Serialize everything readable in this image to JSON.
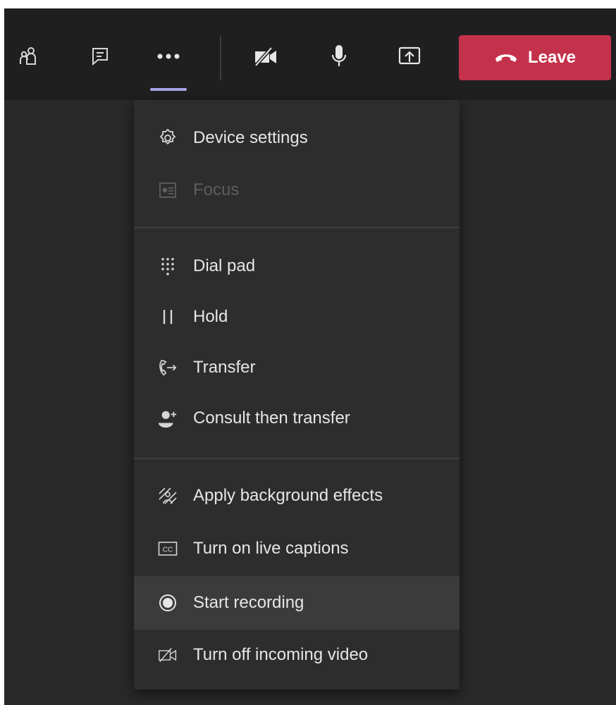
{
  "toolbar": {
    "participants_icon": "people-icon",
    "chat_icon": "chat-icon",
    "more_icon": "more-options-icon",
    "camera_icon": "camera-off-icon",
    "mic_icon": "microphone-icon",
    "share_icon": "share-screen-icon",
    "leave_label": "Leave",
    "leave_color": "#c4314b"
  },
  "menu": {
    "sections": [
      {
        "items": [
          {
            "label": "Device settings",
            "icon": "gear-icon",
            "enabled": true
          },
          {
            "label": "Focus",
            "icon": "focus-icon",
            "enabled": false
          }
        ]
      },
      {
        "items": [
          {
            "label": "Dial pad",
            "icon": "dial-pad-icon",
            "enabled": true
          },
          {
            "label": "Hold",
            "icon": "pause-icon",
            "enabled": true
          },
          {
            "label": "Transfer",
            "icon": "transfer-call-icon",
            "enabled": true
          },
          {
            "label": "Consult then transfer",
            "icon": "add-person-icon",
            "enabled": true
          }
        ]
      },
      {
        "items": [
          {
            "label": "Apply background effects",
            "icon": "background-effects-icon",
            "enabled": true
          },
          {
            "label": "Turn on live captions",
            "icon": "closed-captions-icon",
            "enabled": true
          },
          {
            "label": "Start recording",
            "icon": "record-icon",
            "enabled": true,
            "highlighted": true
          },
          {
            "label": "Turn off incoming video",
            "icon": "video-off-icon",
            "enabled": true
          }
        ]
      }
    ],
    "captions_badge": "CC"
  },
  "colors": {
    "toolbar_bg": "#1f1f1f",
    "stage_bg": "#292929",
    "menu_bg": "#2d2d2d",
    "accent_underline": "#a4a7e8"
  }
}
